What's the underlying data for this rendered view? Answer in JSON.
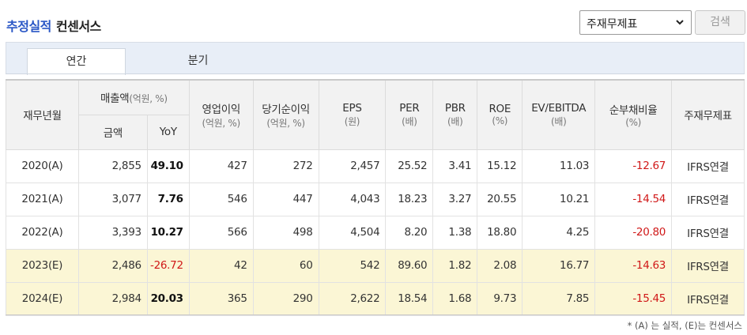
{
  "header": {
    "title_main": "추정실적",
    "title_sub": "컨센서스",
    "select_value": "주재무제표",
    "search_label": "검색"
  },
  "tabs": [
    {
      "label": "연간",
      "active": true
    },
    {
      "label": "분기",
      "active": false
    }
  ],
  "table": {
    "headers": {
      "period": "재무년월",
      "sales": "매출액",
      "sales_unit": "(억원, %)",
      "sales_amount": "금액",
      "sales_yoy": "YoY",
      "op_income": "영업이익",
      "op_income_unit": "(억원, %)",
      "net_income": "당기순이익",
      "net_income_unit": "(억원, %)",
      "eps": "EPS",
      "eps_unit": "(원)",
      "per": "PER",
      "per_unit": "(배)",
      "pbr": "PBR",
      "pbr_unit": "(배)",
      "roe": "ROE",
      "roe_unit": "(%)",
      "ev_ebitda": "EV/EBITDA",
      "ev_ebitda_unit": "(배)",
      "debt_ratio": "순부채비율",
      "debt_ratio_unit": "(%)",
      "statement": "주재무제표"
    },
    "rows": [
      {
        "period": "2020(A)",
        "sales": "2,855",
        "yoy": "49.10",
        "op": "427",
        "net": "272",
        "eps": "2,457",
        "per": "25.52",
        "pbr": "3.41",
        "roe": "15.12",
        "ev": "11.03",
        "debt": "-12.67",
        "stmt": "IFRS연결",
        "estimate": false,
        "yoy_negative": false
      },
      {
        "period": "2021(A)",
        "sales": "3,077",
        "yoy": "7.76",
        "op": "546",
        "net": "447",
        "eps": "4,043",
        "per": "18.23",
        "pbr": "3.27",
        "roe": "20.55",
        "ev": "10.21",
        "debt": "-14.54",
        "stmt": "IFRS연결",
        "estimate": false,
        "yoy_negative": false
      },
      {
        "period": "2022(A)",
        "sales": "3,393",
        "yoy": "10.27",
        "op": "566",
        "net": "498",
        "eps": "4,504",
        "per": "8.20",
        "pbr": "1.38",
        "roe": "18.80",
        "ev": "4.25",
        "debt": "-20.80",
        "stmt": "IFRS연결",
        "estimate": false,
        "yoy_negative": false
      },
      {
        "period": "2023(E)",
        "sales": "2,486",
        "yoy": "-26.72",
        "op": "42",
        "net": "60",
        "eps": "542",
        "per": "89.60",
        "pbr": "1.82",
        "roe": "2.08",
        "ev": "16.77",
        "debt": "-14.63",
        "stmt": "IFRS연결",
        "estimate": true,
        "yoy_negative": true
      },
      {
        "period": "2024(E)",
        "sales": "2,984",
        "yoy": "20.03",
        "op": "365",
        "net": "290",
        "eps": "2,622",
        "per": "18.54",
        "pbr": "1.68",
        "roe": "9.73",
        "ev": "7.85",
        "debt": "-15.45",
        "stmt": "IFRS연결",
        "estimate": true,
        "yoy_negative": false
      }
    ]
  },
  "footnote": "* (A) 는 실적, (E)는 컨센서스",
  "colors": {
    "accent_blue": "#2a57c6",
    "negative_red": "#d01818",
    "estimate_row_bg": "#fbf6d5",
    "tab_bar_bg": "#e8eef7"
  }
}
